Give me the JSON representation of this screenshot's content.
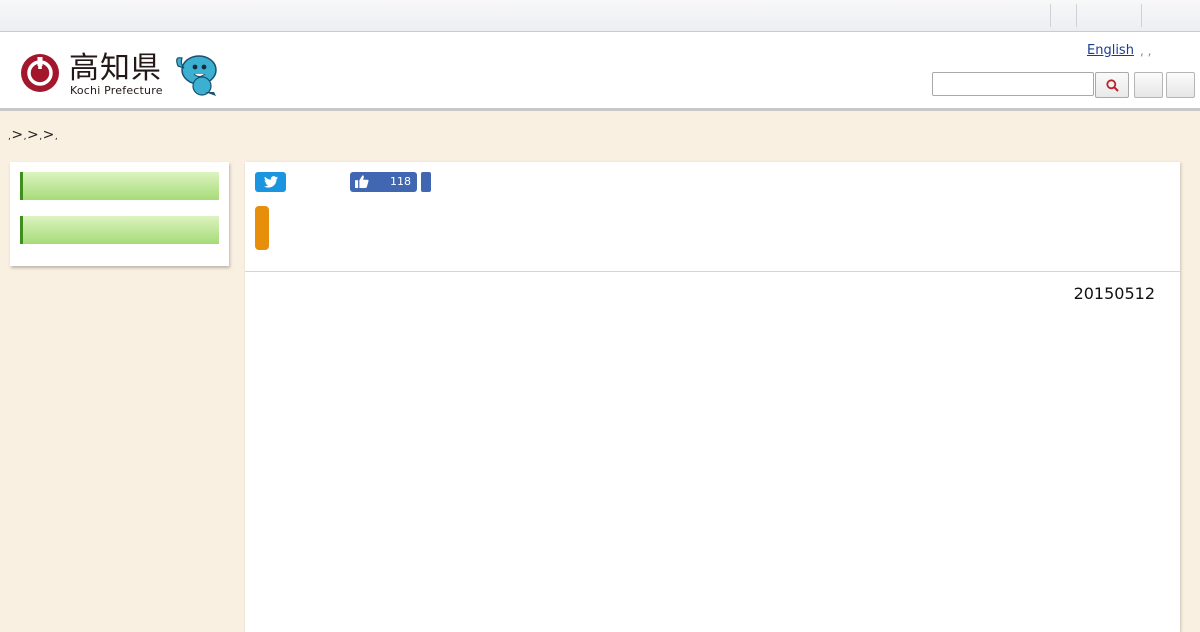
{
  "header": {
    "logo_kanji": "高知県",
    "logo_english": "Kochi Prefecture",
    "lang_link": "English",
    "lang_dots": ", ,",
    "search": {
      "placeholder": ""
    }
  },
  "icons": {
    "emblem": "kochi-emblem-icon",
    "mascot": "mascot-icon",
    "search": "search-icon",
    "twitter": "twitter-icon",
    "like": "thumbs-up-icon"
  },
  "breadcrumb": {
    "items": [
      ",",
      ">",
      ",",
      ">",
      ",",
      ">",
      ","
    ]
  },
  "social": {
    "like_count": "118"
  },
  "article": {
    "date": "20150512"
  },
  "colors": {
    "background": "#faf0e2",
    "emblem_red": "#a3172c",
    "twitter_blue": "#1b95e0",
    "facebook_blue": "#4267b2",
    "accent_orange": "#e78e0a",
    "sidebar_green": "#a6db78"
  }
}
